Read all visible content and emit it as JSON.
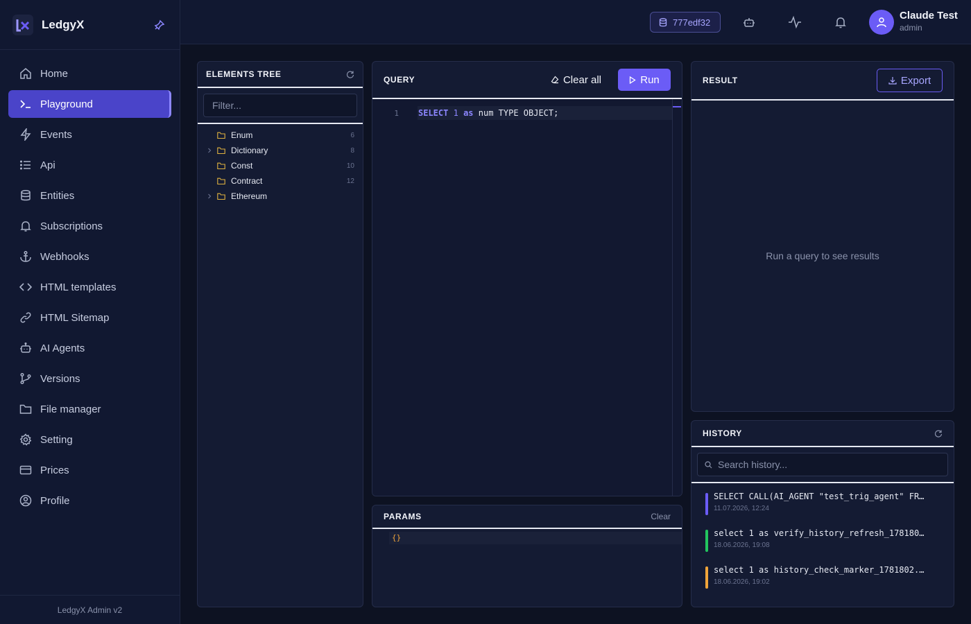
{
  "brand": {
    "name": "LedgyX"
  },
  "nav": [
    {
      "label": "Home",
      "icon": "home-icon"
    },
    {
      "label": "Playground",
      "icon": "terminal-icon",
      "active": true
    },
    {
      "label": "Events",
      "icon": "bolt-icon"
    },
    {
      "label": "Api",
      "icon": "list-icon"
    },
    {
      "label": "Entities",
      "icon": "database-icon"
    },
    {
      "label": "Subscriptions",
      "icon": "bell-icon"
    },
    {
      "label": "Webhooks",
      "icon": "anchor-icon"
    },
    {
      "label": "HTML templates",
      "icon": "code-icon"
    },
    {
      "label": "HTML Sitemap",
      "icon": "link-icon"
    },
    {
      "label": "AI Agents",
      "icon": "robot-icon"
    },
    {
      "label": "Versions",
      "icon": "git-branch-icon"
    },
    {
      "label": "File manager",
      "icon": "folder-icon"
    },
    {
      "label": "Setting",
      "icon": "gear-icon"
    },
    {
      "label": "Prices",
      "icon": "credit-card-icon"
    },
    {
      "label": "Profile",
      "icon": "user-circle-icon"
    }
  ],
  "footer": {
    "version": "LedgyX Admin v2"
  },
  "header": {
    "db_id": "777edf32",
    "user_name": "Claude Test",
    "user_role": "admin"
  },
  "tree": {
    "title": "ELEMENTS TREE",
    "filter_placeholder": "Filter...",
    "items": [
      {
        "label": "Enum",
        "count": "6",
        "expandable": false
      },
      {
        "label": "Dictionary",
        "count": "8",
        "expandable": true
      },
      {
        "label": "Const",
        "count": "10",
        "expandable": false
      },
      {
        "label": "Contract",
        "count": "12",
        "expandable": false
      },
      {
        "label": "Ethereum",
        "count": "",
        "expandable": true
      }
    ]
  },
  "query": {
    "title": "QUERY",
    "clear_label": "Clear all",
    "run_label": "Run",
    "line_number": "1",
    "code": {
      "kw1": "SELECT",
      "num": "1",
      "kw2": "as",
      "rest": "num TYPE OBJECT;"
    }
  },
  "params": {
    "title": "PARAMS",
    "clear_label": "Clear",
    "code": "{}"
  },
  "result": {
    "title": "RESULT",
    "export_label": "Export",
    "empty_text": "Run a query to see results"
  },
  "history": {
    "title": "HISTORY",
    "search_placeholder": "Search history...",
    "items": [
      {
        "query": "SELECT CALL(AI_AGENT \"test_trig_agent\" FROM ...",
        "time": "11.07.2026, 12:24",
        "color": "#6b5cf6"
      },
      {
        "query": "select 1 as verify_history_refresh_1781806...",
        "time": "18.06.2026, 19:08",
        "color": "#22c55e"
      },
      {
        "query": "select 1 as history_check_marker_1781802...",
        "time": "18.06.2026, 19:02",
        "color": "#f0a43a"
      }
    ]
  },
  "colors": {
    "accent": "#6b5cf6",
    "background": "#0d1222",
    "panel": "#141b33"
  }
}
